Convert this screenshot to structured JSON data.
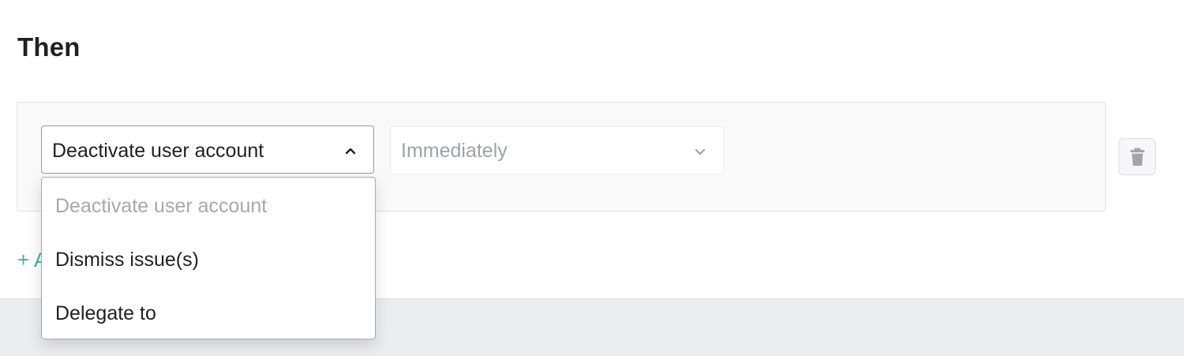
{
  "section": {
    "title": "Then"
  },
  "action_row": {
    "action_select": {
      "value": "Deactivate user account",
      "icon": "chevron-up-icon",
      "expanded": true
    },
    "timing_select": {
      "value": "Immediately",
      "icon": "chevron-down-icon",
      "disabled": true
    },
    "delete_button": {
      "icon": "trash-icon"
    }
  },
  "dropdown": {
    "options": [
      {
        "label": "Deactivate user account",
        "state": "disabled"
      },
      {
        "label": "Dismiss issue(s)",
        "state": "enabled"
      },
      {
        "label": "Delegate to",
        "state": "enabled"
      }
    ]
  },
  "add_action": {
    "label": "+ A"
  },
  "colors": {
    "accent": "#3db5a8",
    "text": "#1f2024",
    "muted_text": "#a5a8ae",
    "card_background": "#f9f9fa",
    "footer_background": "#ecedf1"
  }
}
